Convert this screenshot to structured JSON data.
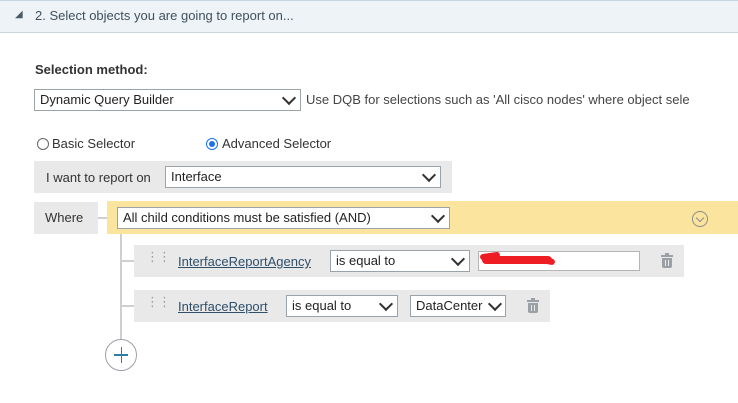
{
  "section": {
    "title": "2. Select objects you are going to report on...",
    "caret_icon": "triangle-collapse-icon"
  },
  "selection_method": {
    "label": "Selection method:",
    "value": "Dynamic Query Builder",
    "hint": "Use DQB for selections such as 'All cisco nodes' where object sele"
  },
  "selector_mode": {
    "basic_label": "Basic Selector",
    "advanced_label": "Advanced Selector",
    "selected": "advanced"
  },
  "report_on": {
    "label": "I want to report on",
    "value": "Interface"
  },
  "where": {
    "label": "Where",
    "condition_mode": "All child conditions must be satisfied (AND)",
    "colors": {
      "group_bg": "#fbe49d",
      "row_bg": "#e9e9e9"
    }
  },
  "conditions": [
    {
      "field": "InterfaceReportAgency",
      "operator": "is equal to",
      "value": ""
    },
    {
      "field": "InterfaceReport",
      "operator": "is equal to",
      "value": "DataCenter"
    }
  ],
  "icons": {
    "drag": "drag-handle-icon",
    "delete": "trash-icon",
    "add": "add-condition-icon",
    "expand": "circle-chevron-down-icon"
  }
}
